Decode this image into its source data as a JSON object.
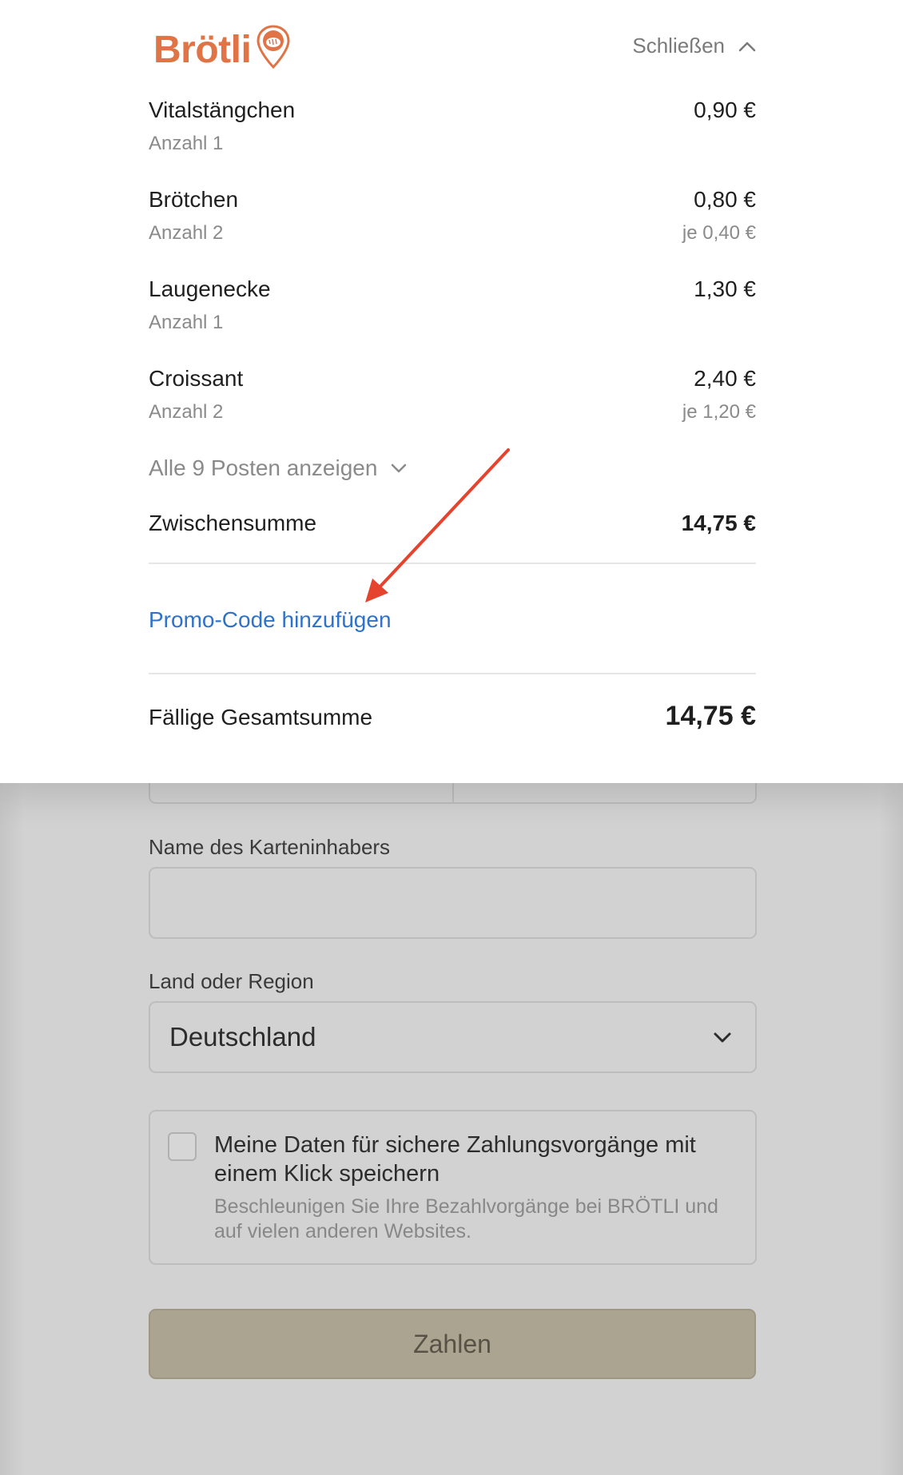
{
  "brand": {
    "name": "Brötli",
    "color": "#e07447"
  },
  "header": {
    "close_label": "Schließen"
  },
  "items": [
    {
      "name": "Vitalstängchen",
      "qty": "Anzahl 1",
      "price": "0,90 €",
      "unit": ""
    },
    {
      "name": "Brötchen",
      "qty": "Anzahl 2",
      "price": "0,80 €",
      "unit": "je 0,40 €"
    },
    {
      "name": "Laugenecke",
      "qty": "Anzahl 1",
      "price": "1,30 €",
      "unit": ""
    },
    {
      "name": "Croissant",
      "qty": "Anzahl 2",
      "price": "2,40 €",
      "unit": "je 1,20 €"
    }
  ],
  "show_all_label": "Alle 9 Posten anzeigen",
  "subtotal": {
    "label": "Zwischensumme",
    "value": "14,75 €"
  },
  "promo": {
    "label": "Promo-Code hinzufügen",
    "color": "#2f72c9"
  },
  "total": {
    "label": "Fällige Gesamtsumme",
    "value": "14,75 €"
  },
  "form": {
    "cardholder_label": "Name des Karteninhabers",
    "cardholder_value": "",
    "country_label": "Land oder Region",
    "country_value": "Deutschland",
    "save_title": "Meine Daten für sichere Zahlungsvorgänge mit einem Klick speichern",
    "save_subtitle": "Beschleunigen Sie Ihre Bezahlvorgänge bei BRÖTLI und auf vielen anderen Websites.",
    "pay_label": "Zahlen"
  },
  "annotation": {
    "color": "#e5432d"
  }
}
